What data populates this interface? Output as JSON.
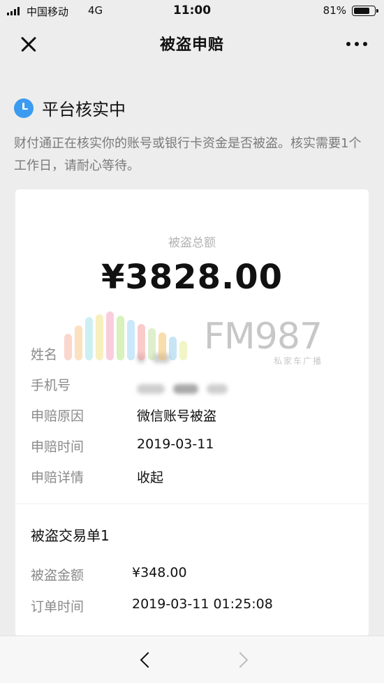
{
  "statusbar": {
    "carrier": "中国移动",
    "network": "4G",
    "time": "11:00",
    "battery": "81%",
    "battery_level": 0.81
  },
  "navbar": {
    "title": "被盗申赔"
  },
  "status": {
    "title": "平台核实中",
    "icon": "clock-icon",
    "description": "财付通正在核实你的账号或银行卡资金是否被盗。核实需要1个工作日，请耐心等待。"
  },
  "card": {
    "total_label": "被盗总额",
    "total_amount": "¥3828.00",
    "rows": [
      {
        "label": "姓名",
        "value": ""
      },
      {
        "label": "手机号",
        "value": ""
      },
      {
        "label": "申赔原因",
        "value": "微信账号被盗"
      },
      {
        "label": "申赔时间",
        "value": "2019-03-11"
      },
      {
        "label": "申赔详情",
        "value": "收起"
      }
    ],
    "section_title": "被盗交易单1",
    "transaction_rows": [
      {
        "label": "被盗金额",
        "value": "¥348.00"
      },
      {
        "label": "订单时间",
        "value": "2019-03-11 01:25:08"
      }
    ]
  },
  "watermark": {
    "text": "FM987",
    "sub": "私家车广播",
    "bar_colors": [
      "#f7b7a3",
      "#f9c98b",
      "#a6e3e9",
      "#f4e28a",
      "#f7a6c2",
      "#b8e986",
      "#9fd6f7",
      "#f7a1a1",
      "#c5e1a5",
      "#f5c26b",
      "#9ad0ec",
      "#e6ee9c"
    ]
  },
  "colors": {
    "accent": "#3b9bf0",
    "background": "#ededed"
  }
}
